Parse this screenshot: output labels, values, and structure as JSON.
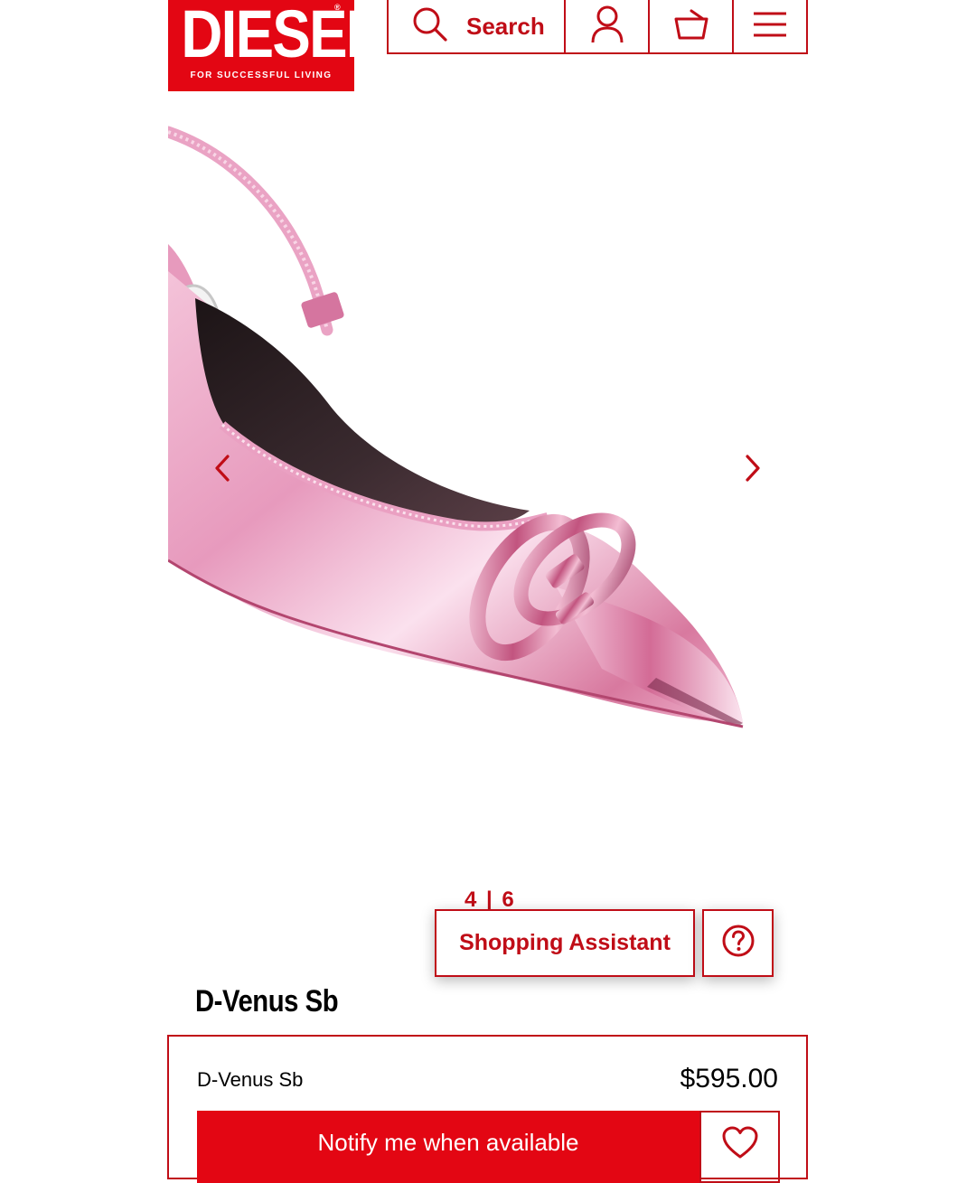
{
  "brand": {
    "logo_text": "DIESEL",
    "registered_mark": "®",
    "tagline": "FOR SUCCESSFUL LIVING",
    "color": "#e30613"
  },
  "header": {
    "search_label": "Search",
    "icons": [
      "search-icon",
      "user-icon",
      "basket-icon",
      "menu-icon"
    ],
    "accent_color": "#c00d17"
  },
  "gallery": {
    "counter": "4 | 6",
    "image": "pink metallic pointed slingback pump with oval D buckle",
    "icons": [
      "chevron-left-icon",
      "chevron-right-icon"
    ]
  },
  "assistant": {
    "label": "Shopping Assistant",
    "icon": "question-circle-icon"
  },
  "product": {
    "title": "D-Venus Sb",
    "name": "D-Venus Sb",
    "price": "$595.00",
    "notify_label": "Notify me when available",
    "wishlist_icon": "heart-icon"
  }
}
